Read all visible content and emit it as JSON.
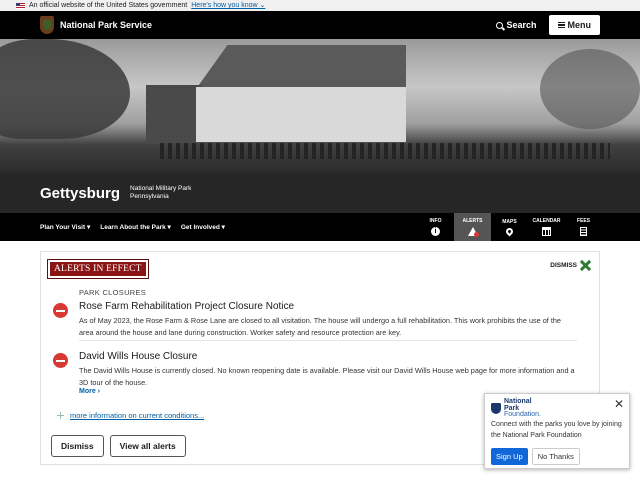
{
  "gov_banner": {
    "text": "An official website of the United States government",
    "link": "Here's how you know"
  },
  "header": {
    "site_name": "National Park Service",
    "search_label": "Search",
    "menu_label": "Menu"
  },
  "park": {
    "title": "Gettysburg",
    "designation": "National Military Park",
    "state": "Pennsylvania"
  },
  "park_nav": {
    "menus": [
      "Plan Your Visit",
      "Learn About the Park",
      "Get Involved"
    ],
    "icons": [
      {
        "label": "INFO",
        "icon": "info-icon"
      },
      {
        "label": "ALERTS",
        "icon": "alert-icon",
        "active": true,
        "count": "2"
      },
      {
        "label": "MAPS",
        "icon": "map-pin-icon"
      },
      {
        "label": "CALENDAR",
        "icon": "calendar-icon"
      },
      {
        "label": "FEES",
        "icon": "fees-icon"
      }
    ]
  },
  "alerts": {
    "heading": "ALERTS IN EFFECT",
    "dismiss_label": "DISMISS",
    "category": "PARK CLOSURES",
    "items": [
      {
        "title": "Rose Farm Rehabilitation Project Closure Notice",
        "body": "As of May 2023, the Rose Farm & Rose Lane are closed to all visitation. The house will undergo a full rehabilitation. This work prohibits the use of the area around the house and lane during construction. Worker safety and resource protection are key."
      },
      {
        "title": "David Wills House Closure",
        "body": "The David Wills House is currently closed. No known reopening date is available. Please visit our David Wills House web page for more information and a 3D tour of the house.",
        "more": "More"
      }
    ],
    "conditions_link": "more information on current conditions...",
    "dismiss_button": "Dismiss",
    "view_all_button": "View all alerts"
  },
  "npf_popup": {
    "logo_line1": "National",
    "logo_line2": "Park",
    "logo_line3": "Foundation.",
    "close": "✕",
    "text": "Connect with the parks you love by joining the National Park Foundation",
    "signup": "Sign Up",
    "no_thanks": "No Thanks"
  }
}
